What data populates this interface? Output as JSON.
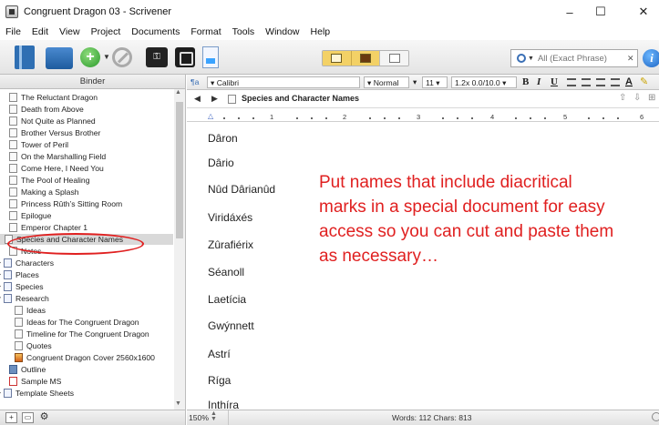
{
  "window": {
    "title": "Congruent Dragon 03 - Scrivener",
    "minimize": "–",
    "maximize": "☐",
    "close": "✕"
  },
  "menu": [
    "File",
    "Edit",
    "View",
    "Project",
    "Documents",
    "Format",
    "Tools",
    "Window",
    "Help"
  ],
  "toolbar": {
    "add_label": "+",
    "search_placeholder": "All (Exact Phrase)",
    "info_label": "i"
  },
  "binder": {
    "header": "Binder",
    "items": [
      {
        "label": "The Reluctant Dragon",
        "icon": "document-icon"
      },
      {
        "label": "Death from Above",
        "icon": "document-icon"
      },
      {
        "label": "Not Quite as Planned",
        "icon": "document-icon"
      },
      {
        "label": "Brother Versus Brother",
        "icon": "document-icon"
      },
      {
        "label": "Tower of Peril",
        "icon": "document-icon"
      },
      {
        "label": "On the Marshalling Field",
        "icon": "document-icon"
      },
      {
        "label": "Come Here, I Need You",
        "icon": "document-icon"
      },
      {
        "label": "The Pool of Healing",
        "icon": "document-icon"
      },
      {
        "label": "Making a Splash",
        "icon": "document-icon"
      },
      {
        "label": "Princess Rûth’s Sitting Room",
        "icon": "document-icon"
      },
      {
        "label": "Epilogue",
        "icon": "document-icon"
      },
      {
        "label": "Emperor Chapter 1",
        "icon": "document-icon"
      },
      {
        "label": "Species and Character Names",
        "icon": "document-icon",
        "selected": true
      },
      {
        "label": "Notes",
        "icon": "document-icon"
      },
      {
        "label": "Characters",
        "icon": "folder-icon"
      },
      {
        "label": "Places",
        "icon": "folder-icon"
      },
      {
        "label": "Species",
        "icon": "folder-icon"
      },
      {
        "label": "Research",
        "icon": "folder-icon"
      },
      {
        "label": "Ideas",
        "icon": "document-icon"
      },
      {
        "label": "Ideas for The Congruent Dragon",
        "icon": "document-icon"
      },
      {
        "label": "Timeline for The Congruent Dragon",
        "icon": "document-icon"
      },
      {
        "label": "Quotes",
        "icon": "document-icon"
      },
      {
        "label": "Congruent Dragon Cover 2560x1600",
        "icon": "image-icon"
      },
      {
        "label": "Outline",
        "icon": "outline-icon"
      },
      {
        "label": "Sample MS",
        "icon": "manuscript-icon"
      },
      {
        "label": "Template Sheets",
        "icon": "folder-icon"
      }
    ]
  },
  "format_bar": {
    "style": "Normal",
    "font": "Calibri",
    "size": "11",
    "spacing": "1.2x 0.0/10.0",
    "bold": "B",
    "italic": "I",
    "underline": "U",
    "text_color_label": "A"
  },
  "document": {
    "title": "Species and Character Names",
    "names": [
      "Dâron",
      "Dârio",
      "Nûd Dârianûd",
      "Viridáxés",
      "Zûrafiérix",
      "Séanoll",
      "Laetícia",
      "Gwýnnett",
      "Astrí",
      "Ríga",
      "Inthíra"
    ],
    "annotation": "Put names that include diacritical marks in a special document for easy access so you can cut and paste them as necessary…"
  },
  "ruler": {
    "numbers": [
      "1",
      "2",
      "3",
      "4",
      "5",
      "6"
    ]
  },
  "status": {
    "zoom": "150%",
    "word_count": "Words: 112   Chars: 813"
  },
  "colors": {
    "annotation": "#e02020",
    "selected_row": "#d9d9d9",
    "view_mode_active": "#f3d166"
  }
}
